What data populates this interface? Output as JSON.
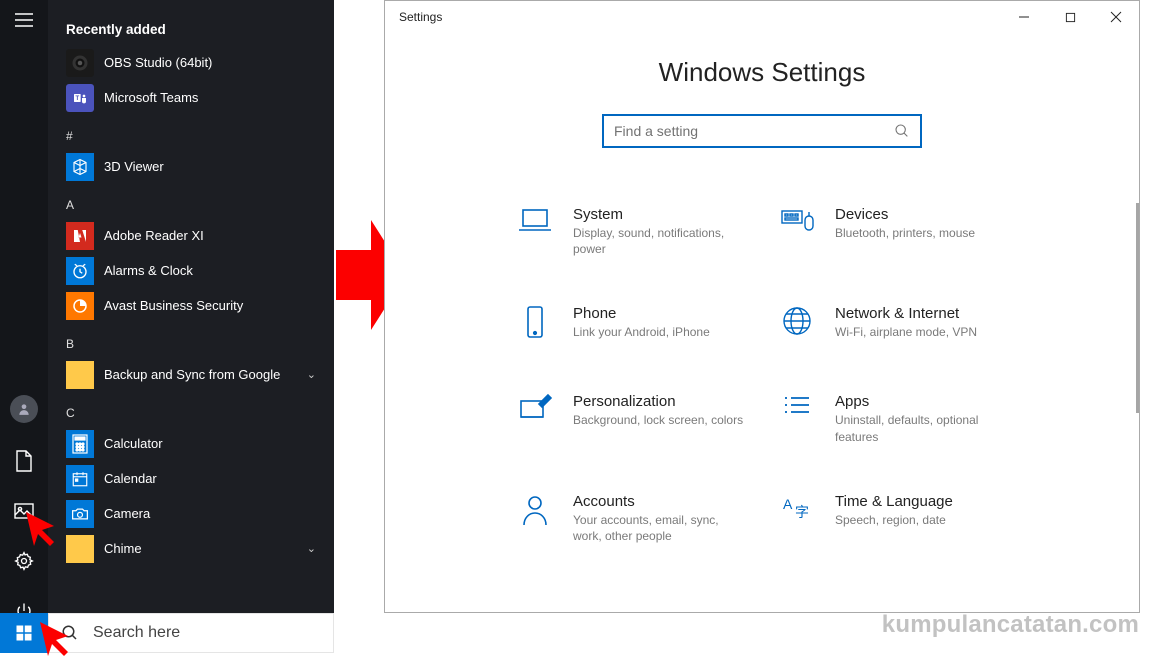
{
  "start": {
    "sections": {
      "recent": {
        "heading": "Recently added"
      },
      "letters": {
        "hash": "#",
        "a": "A",
        "b": "B",
        "c": "C"
      }
    },
    "apps": {
      "obs": "OBS Studio (64bit)",
      "teams": "Microsoft Teams",
      "viewer3d": "3D Viewer",
      "adobe": "Adobe Reader XI",
      "alarms": "Alarms & Clock",
      "avast": "Avast Business Security",
      "backup": "Backup and Sync from Google",
      "calculator": "Calculator",
      "calendar": "Calendar",
      "camera": "Camera",
      "chime": "Chime"
    },
    "search_placeholder": "Search here"
  },
  "settings": {
    "window_title": "Settings",
    "page_title": "Windows Settings",
    "search_placeholder": "Find a setting",
    "categories": [
      {
        "title": "System",
        "desc": "Display, sound, notifications, power"
      },
      {
        "title": "Devices",
        "desc": "Bluetooth, printers, mouse"
      },
      {
        "title": "Phone",
        "desc": "Link your Android, iPhone"
      },
      {
        "title": "Network & Internet",
        "desc": "Wi-Fi, airplane mode, VPN"
      },
      {
        "title": "Personalization",
        "desc": "Background, lock screen, colors"
      },
      {
        "title": "Apps",
        "desc": "Uninstall, defaults, optional features"
      },
      {
        "title": "Accounts",
        "desc": "Your accounts, email, sync, work, other people"
      },
      {
        "title": "Time & Language",
        "desc": "Speech, region, date"
      }
    ]
  },
  "watermark": "kumpulancatatan.com"
}
